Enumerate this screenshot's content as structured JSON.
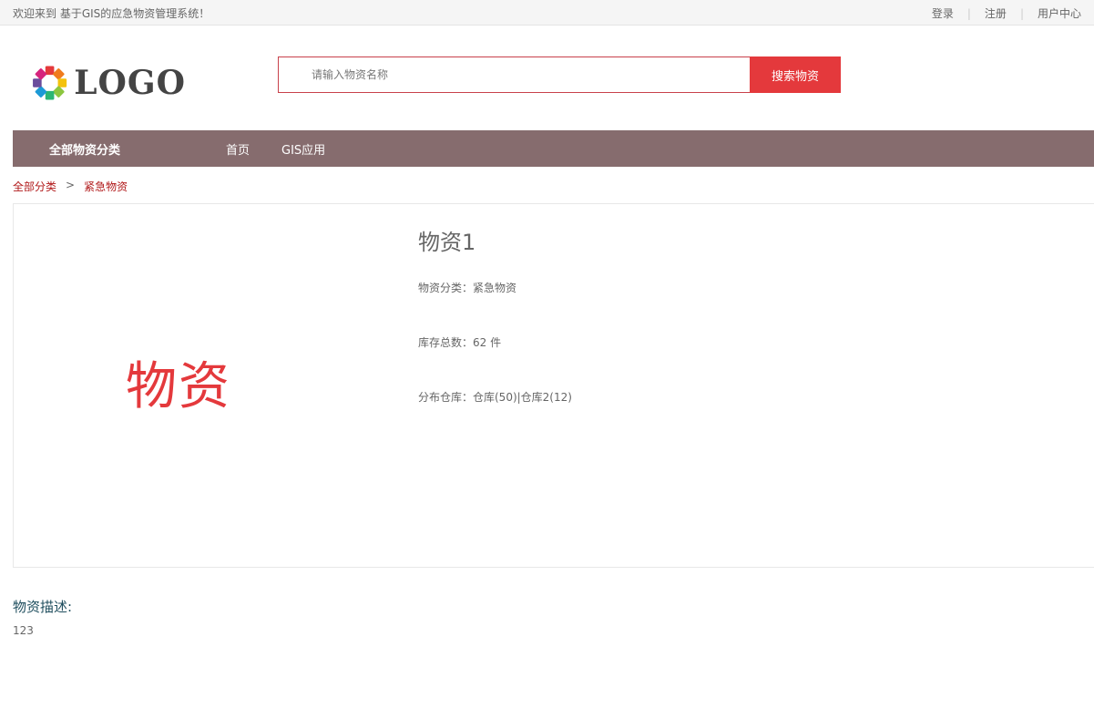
{
  "topbar": {
    "welcome": "欢迎来到 基于GIS的应急物资管理系统！",
    "login": "登录",
    "register": "注册",
    "user_center": "用户中心",
    "separator": "|"
  },
  "logo": {
    "text": "LOGO"
  },
  "search": {
    "placeholder": "请输入物资名称",
    "value": "",
    "button_label": "搜索物资"
  },
  "navbar": {
    "all_categories": "全部物资分类",
    "items": [
      {
        "label": "首页"
      },
      {
        "label": "GIS应用"
      }
    ]
  },
  "breadcrumb": {
    "root": "全部分类",
    "separator": ">",
    "current": "紧急物资"
  },
  "product": {
    "image_text": "物资",
    "title": "物资1",
    "category": "物资分类：紧急物资",
    "stock": "库存总数：62 件",
    "warehouses": "分布仓库：仓库(50)|仓库2(12)"
  },
  "description": {
    "title": "物资描述:",
    "text": "123"
  },
  "colors": {
    "accent": "#e4393c",
    "nav_bg": "#866c6e",
    "breadcrumb": "#b1191a"
  }
}
